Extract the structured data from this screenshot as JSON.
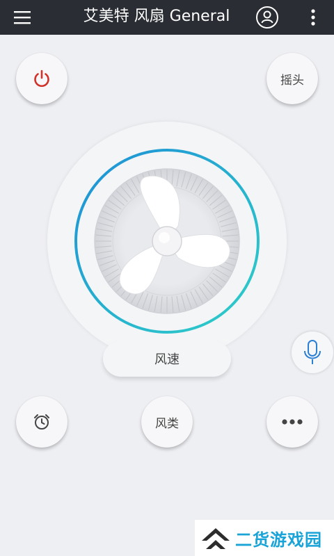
{
  "app_bar": {
    "title": "艾美特 风扇 General",
    "menu_icon": "hamburger-menu-icon",
    "user_icon": "user-account-icon",
    "more_icon": "more-vertical-icon",
    "background": "#2a2d34"
  },
  "controls": {
    "power": {
      "icon": "power-icon",
      "color": "#d0322a"
    },
    "oscillate_label": "摇头",
    "speed_label": "风速",
    "timer": {
      "icon": "alarm-clock-icon"
    },
    "mode_label": "风类",
    "more": {
      "icon": "more-horizontal-icon"
    },
    "mic": {
      "icon": "microphone-icon",
      "color": "#2b7fd4"
    }
  },
  "fan_display": {
    "icon": "fan-icon",
    "ring_colors": [
      "#1d8fd6",
      "#2fd0c8"
    ]
  },
  "watermark": {
    "text": "二货游戏园",
    "color": "#1aa3d6",
    "logo": "double-chevron-logo"
  }
}
